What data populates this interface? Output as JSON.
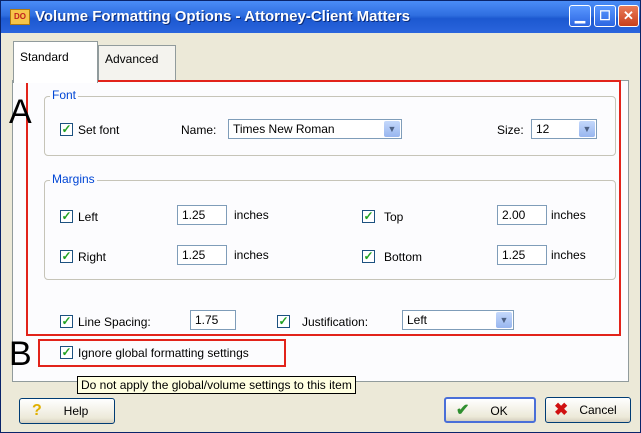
{
  "window": {
    "title": "Volume Formatting Options - Attorney-Client Matters",
    "app_icon_text": "DO"
  },
  "tabs": [
    {
      "label": "Standard",
      "selected": true
    },
    {
      "label": "Advanced",
      "selected": false
    }
  ],
  "callouts": {
    "a": "A",
    "b": "B"
  },
  "font_group": {
    "legend": "Font",
    "set_font_label": "Set font",
    "set_font_checked": true,
    "name_label": "Name:",
    "name_value": "Times New Roman",
    "size_label": "Size:",
    "size_value": "12"
  },
  "margins_group": {
    "legend": "Margins",
    "left": {
      "label": "Left",
      "value": "1.25",
      "unit": "inches",
      "checked": true
    },
    "right": {
      "label": "Right",
      "value": "1.25",
      "unit": "inches",
      "checked": true
    },
    "top": {
      "label": "Top",
      "value": "2.00",
      "unit": "inches",
      "checked": true
    },
    "bottom": {
      "label": "Bottom",
      "value": "1.25",
      "unit": "inches",
      "checked": true
    }
  },
  "line_spacing": {
    "label": "Line Spacing:",
    "value": "1.75",
    "checked": true
  },
  "justification": {
    "label": "Justification:",
    "value": "Left",
    "checked": true
  },
  "ignore_global": {
    "label": "Ignore global formatting settings",
    "checked": true
  },
  "tooltip": "Do not apply the global/volume settings to this item",
  "buttons": {
    "help": "Help",
    "ok": "OK",
    "cancel": "Cancel"
  },
  "colors": {
    "highlight_box": "#e2231a",
    "group_legend": "#0046d5",
    "checkmark": "#21a121"
  }
}
